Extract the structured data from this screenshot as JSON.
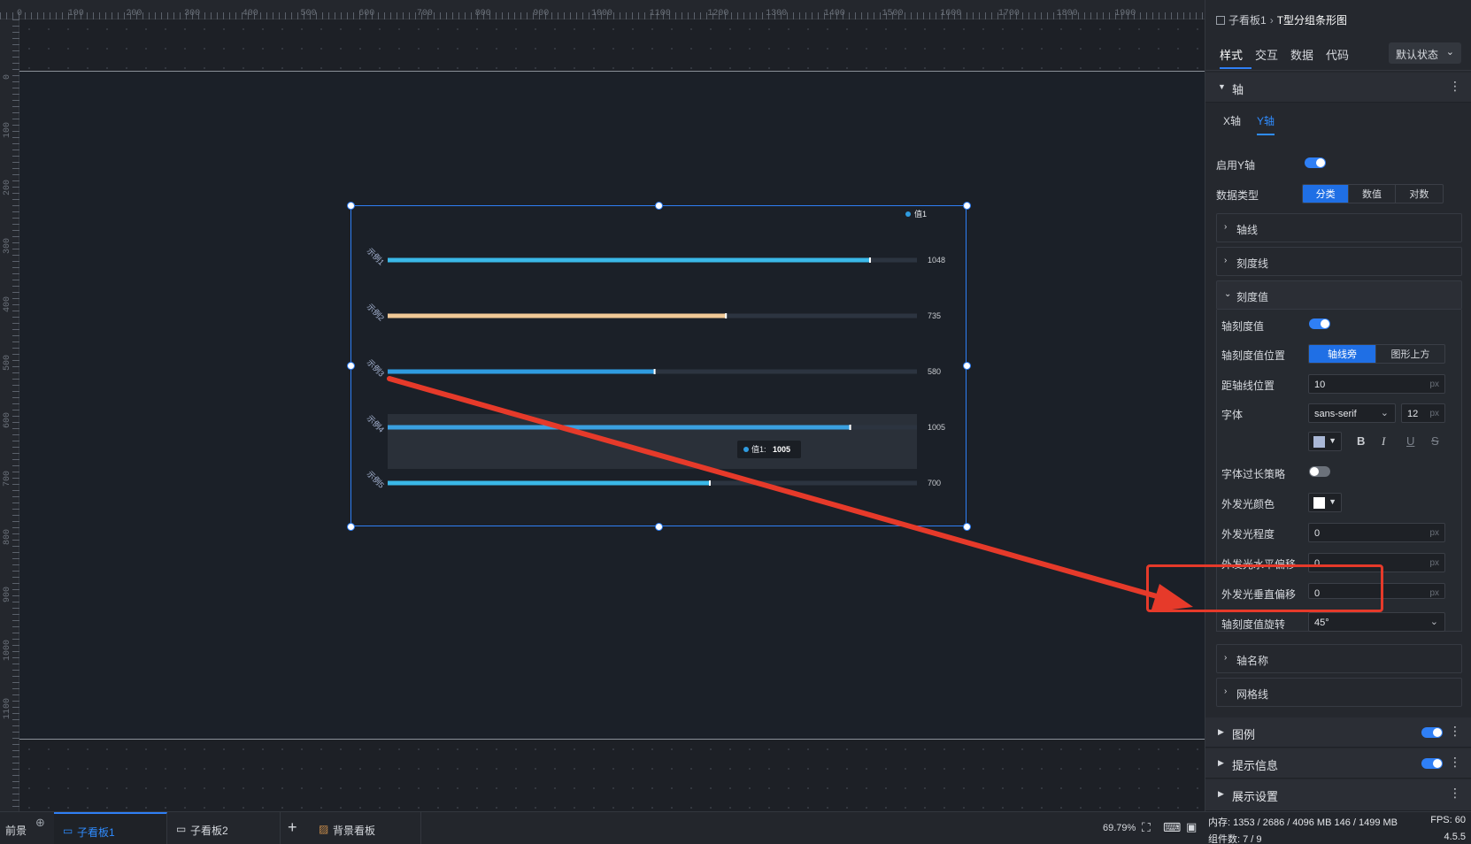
{
  "ruler": {
    "top_labels": [
      "0",
      "100",
      "200",
      "300",
      "400",
      "500",
      "600",
      "700",
      "800",
      "900",
      "1000",
      "1100",
      "1200",
      "1300",
      "1400",
      "1500",
      "1600",
      "1700",
      "1800",
      "1900"
    ],
    "left_labels": [
      "0",
      "100",
      "200",
      "300",
      "400",
      "500",
      "600",
      "700",
      "800",
      "900",
      "1000",
      "1100"
    ]
  },
  "chart_data": {
    "type": "bar",
    "orientation": "horizontal",
    "categories": [
      "示例1",
      "示例2",
      "示例3",
      "示例4",
      "示例5"
    ],
    "series": [
      {
        "name": "值1",
        "values": [
          1048,
          735,
          580,
          1005,
          700
        ]
      }
    ],
    "value_labels": [
      "1048",
      "735",
      "580",
      "1005",
      "700"
    ],
    "bar_colors": [
      "#3ab8e8",
      "#f0c896",
      "#2f9be0",
      "#3aa0e0",
      "#3ab8e8"
    ],
    "track_color": "#2c3440",
    "xlim": [
      0,
      1150
    ],
    "legend": {
      "label": "值1",
      "placement": "top-right",
      "color": "#2f9be0"
    },
    "tooltip": {
      "label": "值1:",
      "value": "1005"
    },
    "tick_rotation": "45°"
  },
  "panel": {
    "breadcrumb": [
      "子看板1",
      "T型分组条形图"
    ],
    "breadcrumb_sep": "›",
    "tabs": [
      "样式",
      "交互",
      "数据",
      "代码"
    ],
    "state_select": "默认状态",
    "sections": {
      "axis": "轴",
      "legend": "图例",
      "tooltip": "提示信息",
      "display": "展示设置"
    },
    "axis_tabs": [
      "X轴",
      "Y轴"
    ],
    "enable_y": "启用Y轴",
    "data_type_label": "数据类型",
    "data_type_options": [
      "分类",
      "数值",
      "对数"
    ],
    "collapse": {
      "axis_line": "轴线",
      "tick_line": "刻度线",
      "tick_value": "刻度值",
      "axis_name": "轴名称",
      "grid_line": "网格线"
    },
    "tick": {
      "show_label": "轴刻度值",
      "position_label": "轴刻度值位置",
      "position_options": [
        "轴线旁",
        "图形上方"
      ],
      "distance_label": "距轴线位置",
      "distance_value": "10",
      "font_label": "字体",
      "font_family": "sans-serif",
      "font_size": "12",
      "font_color": "#a9b7d6",
      "bold": "B",
      "italic": "I",
      "underline": "U",
      "strike": "S",
      "overflow_label": "字体过长策略",
      "glow_color_label": "外发光颜色",
      "glow_color": "#ffffff",
      "glow_level_label": "外发光程度",
      "glow_level": "0",
      "glow_h_label": "外发光水平偏移",
      "glow_h": "0",
      "glow_v_label": "外发光垂直偏移",
      "glow_v": "0",
      "rotate_label": "轴刻度值旋转",
      "rotate_value": "45°",
      "unit": "px"
    }
  },
  "bottom": {
    "foreground": "前景",
    "tabs": [
      "子看板1",
      "子看板2"
    ],
    "add": "+",
    "background_board": "背景看板",
    "zoom": "69.79%"
  },
  "status": {
    "memory": "内存:  1353 / 2686 / 4096 MB  146 / 1499 MB",
    "fps": "FPS:  60",
    "components": "组件数: 7 / 9",
    "version": "4.5.5"
  }
}
